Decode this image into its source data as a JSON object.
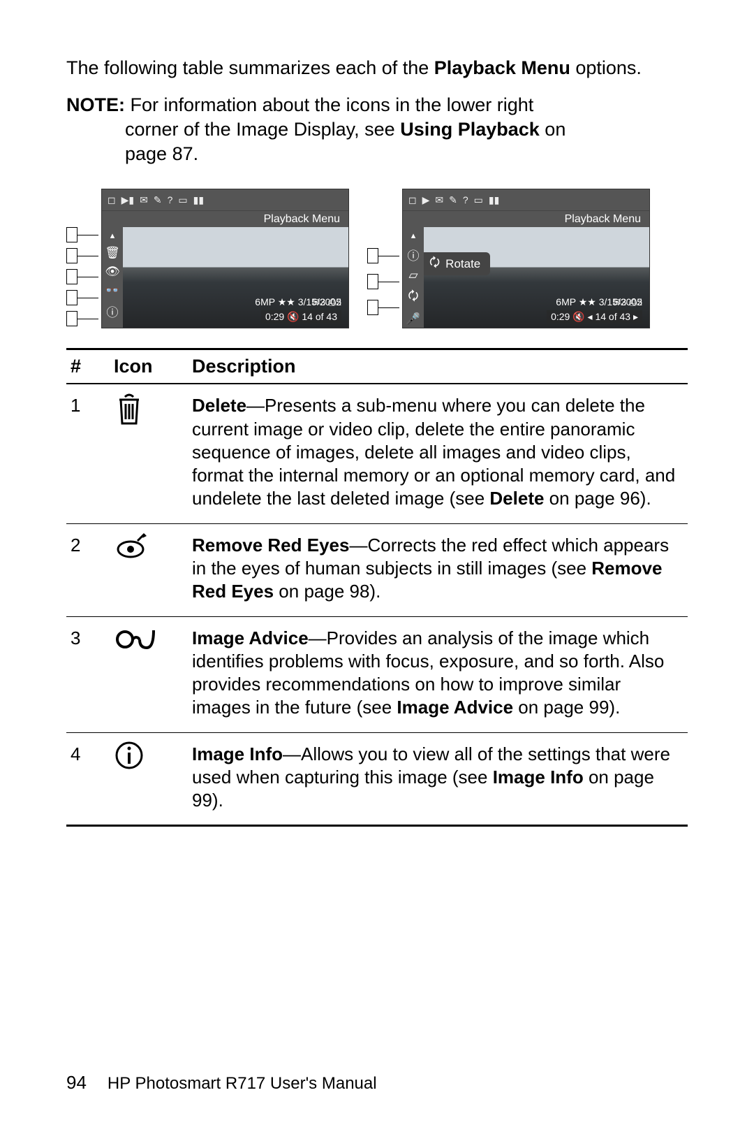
{
  "intro": {
    "pre": "The following table summarizes each of the ",
    "bold": "Playback Menu",
    "post": " options."
  },
  "note": {
    "label": "NOTE:",
    "line1": "For information about the icons in the lower right",
    "line2_pre": "corner of the Image Display, see ",
    "line2_bold": "Using Playback",
    "line2_post": " on",
    "line3": "page 87."
  },
  "lcd": {
    "title": "Playback Menu",
    "rotate_label": "Rotate",
    "overlay_top_a": "✉3  ⎙2",
    "overlay_mid": "6MP ★★  3/15/2005",
    "overlay_bot_left": "0:29 🔇  14 of 43",
    "overlay_bot_right": "0:29 🔇  ◂ 14 of 43 ▸"
  },
  "table": {
    "headers": {
      "num": "#",
      "icon": "Icon",
      "desc": "Description"
    },
    "rows": [
      {
        "num": "1",
        "icon": "trash",
        "title": "Delete",
        "body_a": "—Presents a sub-menu where you can delete the current image or video clip, delete the entire panoramic sequence of images, delete all images and video clips, format the internal memory or an optional memory card, and undelete the last deleted image (see ",
        "ref": "Delete",
        "body_b": " on page 96)."
      },
      {
        "num": "2",
        "icon": "redeye",
        "title": "Remove Red Eyes",
        "body_a": "—Corrects the red effect which appears in the eyes of human subjects in still images (see ",
        "ref": "Remove Red Eyes",
        "body_b": " on page 98)."
      },
      {
        "num": "3",
        "icon": "glasses",
        "title": "Image Advice",
        "body_a": "—Provides an analysis of the image which identifies problems with focus, exposure, and so forth. Also provides recommendations on how to improve similar images in the future (see ",
        "ref": "Image Advice",
        "body_b": " on page 99)."
      },
      {
        "num": "4",
        "icon": "info",
        "title": "Image Info",
        "body_a": "—Allows you to view all of the settings that were used when capturing this image (see ",
        "ref": "Image Info",
        "body_b": " on page 99)."
      }
    ]
  },
  "footer": {
    "page": "94",
    "title": "HP Photosmart R717 User's Manual"
  }
}
